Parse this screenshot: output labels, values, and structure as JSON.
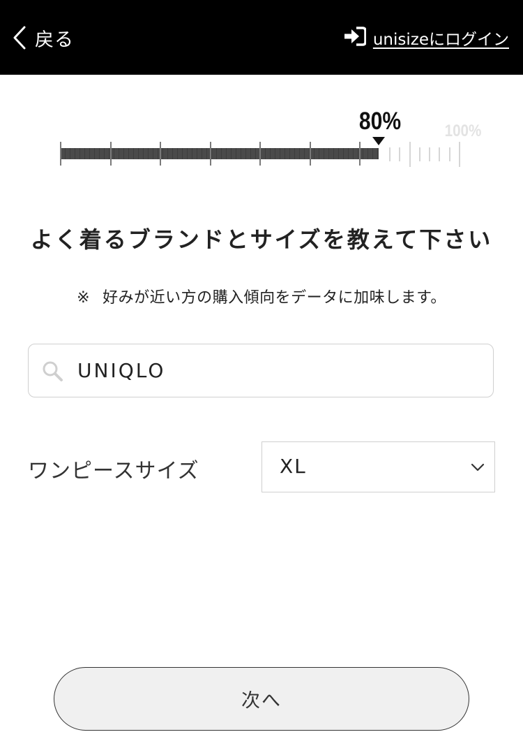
{
  "header": {
    "back_label": "戻る",
    "login_label": "unisizeにログイン"
  },
  "progress": {
    "current_label": "80%",
    "max_label": "100%",
    "value": 0.8
  },
  "title": "よく着るブランドとサイズを教えて下さい",
  "note": {
    "mark": "※",
    "text": "好みが近い方の購入傾向をデータに加味します。"
  },
  "search": {
    "value": "UNIQLO",
    "icon": "search-icon"
  },
  "size": {
    "label": "ワンピースサイズ",
    "selected": "XL"
  },
  "next_button": {
    "label": "次へ"
  },
  "colors": {
    "header_bg": "#000000",
    "progress_fill": "#4a4a4a",
    "button_bg": "#f0f0f0"
  }
}
